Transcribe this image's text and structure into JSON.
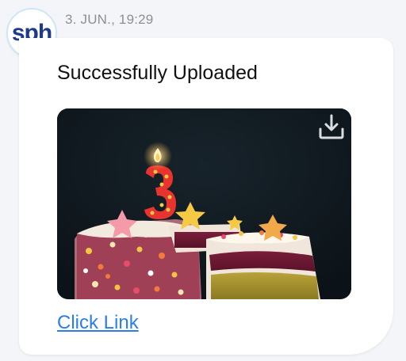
{
  "sender": {
    "avatar_text": "sph"
  },
  "message": {
    "timestamp": "3. JUN., 19:29",
    "title": "Successfully Uploaded",
    "image": {
      "subject": "birthday-cake-with-number-3-candle",
      "download_icon": "download-icon"
    },
    "link_label": "Click Link"
  },
  "colors": {
    "background": "#f4f5f8",
    "bubble": "#ffffff",
    "link": "#2b7de9",
    "timestamp": "#8d8f94",
    "avatar_ring": "#cfe7f5",
    "avatar_text": "#1f3a8a"
  }
}
